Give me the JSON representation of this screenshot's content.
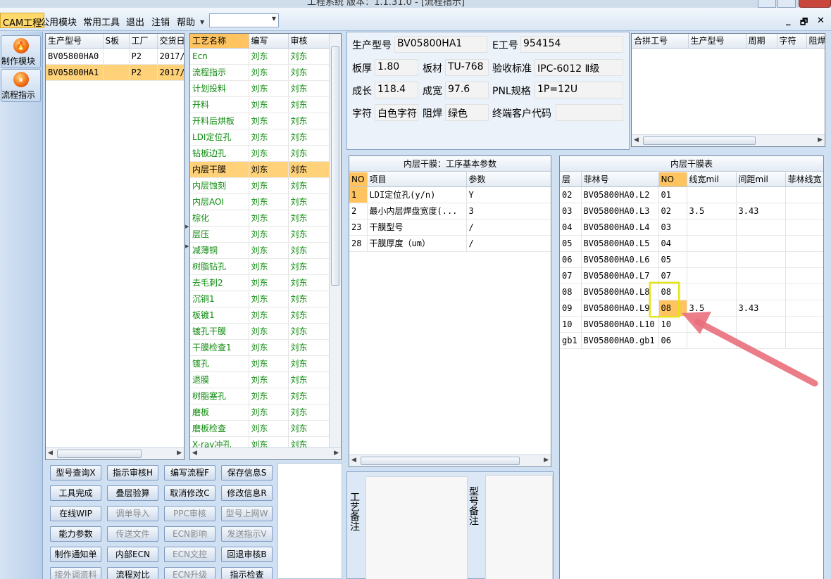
{
  "titlebar": {
    "title": "工程系统   版本：1.1.31.0 - [流程指示]"
  },
  "menu": {
    "items": [
      "CAM工程",
      "公用模块",
      "常用工具",
      "退出",
      "注销",
      "帮助"
    ],
    "combo_value": ""
  },
  "window_controls": {
    "minimize": "_",
    "restore": "🗗",
    "close": "✕"
  },
  "left_nav": [
    {
      "label": "制作模块",
      "icon": "flame-icon"
    },
    {
      "label": "流程指示",
      "icon": "flow-icon"
    }
  ],
  "model_grid": {
    "headers": [
      "生产型号",
      "S板",
      "工厂",
      "交货日"
    ],
    "rows": [
      [
        "BV05800HA0",
        "",
        "P2",
        "2017/"
      ],
      [
        "BV05800HA1",
        "",
        "P2",
        "2017/"
      ]
    ],
    "selected_index": 1
  },
  "process_grid": {
    "headers": [
      "工艺名称",
      "编写",
      "审核"
    ],
    "rows": [
      [
        "Ecn",
        "刘东",
        "刘东"
      ],
      [
        "流程指示",
        "刘东",
        "刘东"
      ],
      [
        "计划投料",
        "刘东",
        "刘东"
      ],
      [
        "开料",
        "刘东",
        "刘东"
      ],
      [
        "开料后烘板",
        "刘东",
        "刘东"
      ],
      [
        "LDI定位孔",
        "刘东",
        "刘东"
      ],
      [
        "钻板边孔",
        "刘东",
        "刘东"
      ],
      [
        "内层干膜",
        "刘东",
        "刘东"
      ],
      [
        "内层蚀刻",
        "刘东",
        "刘东"
      ],
      [
        "内层AOI",
        "刘东",
        "刘东"
      ],
      [
        "棕化",
        "刘东",
        "刘东"
      ],
      [
        "层压",
        "刘东",
        "刘东"
      ],
      [
        "减薄铜",
        "刘东",
        "刘东"
      ],
      [
        "树脂钻孔",
        "刘东",
        "刘东"
      ],
      [
        "去毛刺2",
        "刘东",
        "刘东"
      ],
      [
        "沉铜1",
        "刘东",
        "刘东"
      ],
      [
        "板镀1",
        "刘东",
        "刘东"
      ],
      [
        "镀孔干膜",
        "刘东",
        "刘东"
      ],
      [
        "干膜检查1",
        "刘东",
        "刘东"
      ],
      [
        "镀孔",
        "刘东",
        "刘东"
      ],
      [
        "退膜",
        "刘东",
        "刘东"
      ],
      [
        "树脂塞孔",
        "刘东",
        "刘东"
      ],
      [
        "磨板",
        "刘东",
        "刘东"
      ],
      [
        "磨板检查",
        "刘东",
        "刘东"
      ],
      [
        "X-ray冲孔",
        "刘东",
        "刘东"
      ]
    ],
    "selected_index": 7
  },
  "info": {
    "production_model_label": "生产型号",
    "production_model": "BV05800HA1",
    "e_no_label": "E工号",
    "e_no": "954154",
    "thickness_label": "板厚",
    "thickness": "1.80",
    "material_label": "板材",
    "material": "TU-768",
    "standard_label": "验收标准",
    "standard": "IPC-6012 Ⅱ级",
    "length_label": "成长",
    "length": "118.4",
    "width_label": "成宽",
    "width": "97.6",
    "pnl_label": "PNL规格",
    "pnl": "1P=12U",
    "char_label": "字符",
    "char": "白色字符",
    "mask_label": "阻焊",
    "mask": "绿色",
    "customer_label": "终端客户代码",
    "customer": ""
  },
  "combine_grid": {
    "headers": [
      "合拼工号",
      "生产型号",
      "周期",
      "字符",
      "阻焊"
    ]
  },
  "params_section": {
    "title": "内层干膜：工序基本参数",
    "headers": [
      "NO",
      "项目",
      "参数"
    ],
    "rows": [
      [
        "1",
        "LDI定位孔(y/n)",
        "Y"
      ],
      [
        "2",
        "最小内层焊盘宽度(...",
        "3"
      ],
      [
        "23",
        "干膜型号",
        "/"
      ],
      [
        "28",
        "干膜厚度（um）",
        "/"
      ]
    ]
  },
  "film_section": {
    "title": "内层干膜表",
    "headers": [
      "层",
      "菲林号",
      "NO",
      "线宽mil",
      "间距mil",
      "菲林线宽"
    ],
    "rows": [
      [
        "02",
        "BV05800HA0.L2",
        "01",
        "",
        "",
        ""
      ],
      [
        "03",
        "BV05800HA0.L3",
        "02",
        "3.5",
        "3.43",
        ""
      ],
      [
        "04",
        "BV05800HA0.L4",
        "03",
        "",
        "",
        ""
      ],
      [
        "05",
        "BV05800HA0.L5",
        "04",
        "",
        "",
        ""
      ],
      [
        "06",
        "BV05800HA0.L6",
        "05",
        "",
        "",
        ""
      ],
      [
        "07",
        "BV05800HA0.L7",
        "07",
        "",
        "",
        ""
      ],
      [
        "08",
        "BV05800HA0.L8",
        "08",
        "",
        "",
        ""
      ],
      [
        "09",
        "BV05800HA0.L9",
        "08",
        "3.5",
        "3.43",
        ""
      ],
      [
        "10",
        "BV05800HA0.L10",
        "10",
        "",
        "",
        ""
      ],
      [
        "gb1",
        "BV05800HA0.gb1",
        "06",
        "",
        "",
        ""
      ]
    ]
  },
  "buttons": [
    {
      "label": "型号查询X",
      "enabled": true
    },
    {
      "label": "指示审核H",
      "enabled": true
    },
    {
      "label": "编写流程F",
      "enabled": true
    },
    {
      "label": "保存信息S",
      "enabled": true
    },
    {
      "label": "工具完成",
      "enabled": true
    },
    {
      "label": "叠层验算",
      "enabled": true
    },
    {
      "label": "取消修改C",
      "enabled": true
    },
    {
      "label": "修改信息R",
      "enabled": true
    },
    {
      "label": "在线WIP",
      "enabled": true
    },
    {
      "label": "调单导入",
      "enabled": false
    },
    {
      "label": "PPC审核",
      "enabled": false
    },
    {
      "label": "型号上网W",
      "enabled": false
    },
    {
      "label": "能力参数",
      "enabled": true
    },
    {
      "label": "传送文件",
      "enabled": false
    },
    {
      "label": "ECN影响",
      "enabled": false
    },
    {
      "label": "发送指示V",
      "enabled": false
    },
    {
      "label": "制作通知单",
      "enabled": true
    },
    {
      "label": "内部ECN",
      "enabled": true
    },
    {
      "label": "ECN文控",
      "enabled": false
    },
    {
      "label": "回退审核B",
      "enabled": true
    },
    {
      "label": "接外调资料",
      "enabled": false
    },
    {
      "label": "流程对比",
      "enabled": true
    },
    {
      "label": "ECN升级",
      "enabled": false
    },
    {
      "label": "指示检查",
      "enabled": true
    }
  ],
  "notes": {
    "process_note_label": "工艺备注",
    "model_note_label": "型号备注"
  },
  "colors": {
    "selection": "#ffd27a",
    "highlight_box": "#e5e51a",
    "arrow": "#e9707c",
    "green_text": "#0c8a0c"
  }
}
